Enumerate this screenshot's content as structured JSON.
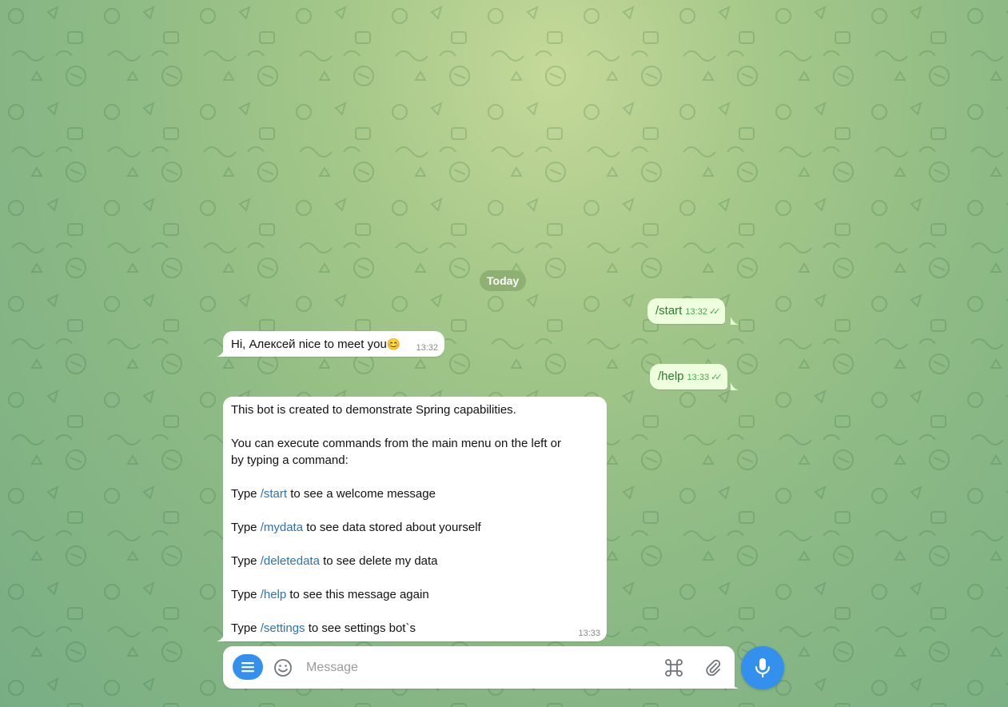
{
  "chat": {
    "date_separator": "Today",
    "messages": [
      {
        "id": "m1",
        "direction": "out",
        "text": "/start",
        "time": "13:32",
        "status": "read"
      },
      {
        "id": "m2",
        "direction": "in",
        "text": "Hi, Алексей nice to meet you",
        "emoji": "😊",
        "time": "13:32"
      },
      {
        "id": "m3",
        "direction": "out",
        "text": "/help",
        "time": "13:33",
        "status": "read"
      },
      {
        "id": "m4",
        "direction": "in",
        "time": "13:33",
        "intro": "This bot is created to demonstrate Spring capabilities.",
        "info_line1": "You can execute commands from the main menu on the left or",
        "info_line2": "by typing a command:",
        "commands": [
          {
            "prefix": "Type ",
            "command": "/start",
            "suffix": " to see a welcome message"
          },
          {
            "prefix": "Type ",
            "command": "/mydata",
            "suffix": " to see data stored about yourself"
          },
          {
            "prefix": "Type ",
            "command": "/deletedata",
            "suffix": " to see delete my data"
          },
          {
            "prefix": "Type ",
            "command": "/help",
            "suffix": " to see this message again"
          },
          {
            "prefix": "Type ",
            "command": "/settings",
            "suffix": " to see settings bot`s"
          }
        ]
      }
    ]
  },
  "composer": {
    "placeholder": "Message",
    "value": ""
  },
  "icons": {
    "menu": "menu-icon",
    "emoji": "smile-icon",
    "commands": "command-key-icon",
    "attach": "paperclip-icon",
    "mic": "microphone-icon",
    "read": "double-check-icon"
  },
  "colors": {
    "accent": "#3390ec",
    "outgoing_bubble": "#eeffde",
    "outgoing_text": "#2c7a2c",
    "incoming_bubble": "#ffffff",
    "link": "#2b72b5",
    "date_pill": "#8fb073"
  }
}
